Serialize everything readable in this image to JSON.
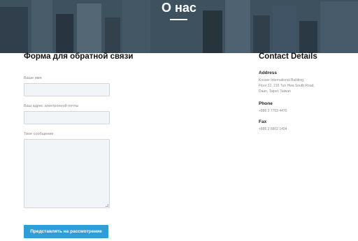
{
  "hero": {
    "title": "О нас"
  },
  "form": {
    "title": "Форма для обратной связи",
    "name_label": "Ваше имя",
    "email_label": "Ваш адрес электронной почты",
    "message_label": "Твое сообщение",
    "submit_label": "Представлять на рассмотрение"
  },
  "contact": {
    "title": "Contact Details",
    "address_heading": "Address",
    "address_line1": "Kouser International Building,",
    "address_line2": "Floor 22, 216 Tun Hwa South Road,",
    "address_line3": "Daan, Taipei, Taiwan",
    "phone_heading": "Phone",
    "phone_value": "+886 2 7703 4470",
    "fax_heading": "Fax",
    "fax_value": "+886 2 6602 1404"
  },
  "colors": {
    "accent": "#2f9ed6",
    "input_bg": "#f2f5f8"
  }
}
